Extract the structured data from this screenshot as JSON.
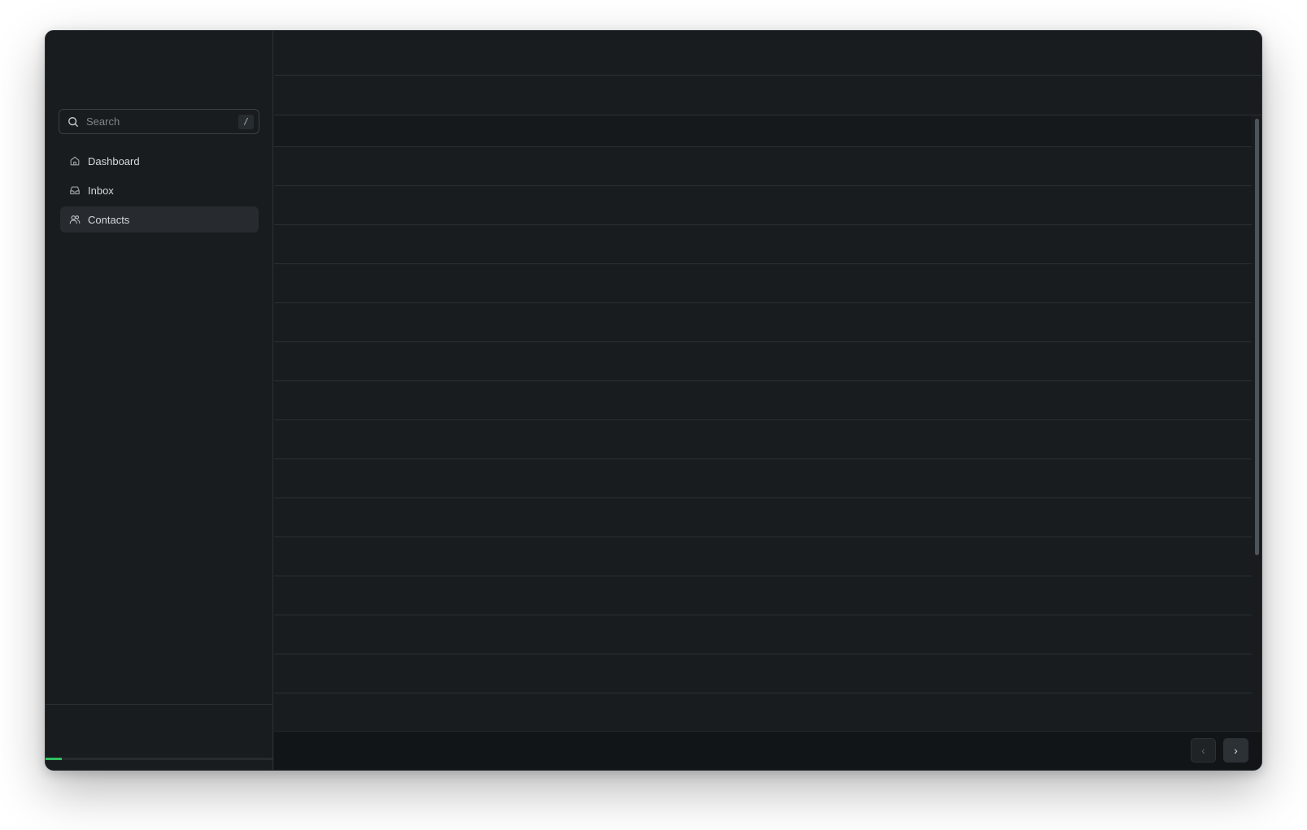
{
  "window": {
    "traffic_colors": [
      "#f5843a",
      "#f5843a",
      "#2dc154"
    ]
  },
  "sidebar": {
    "search": {
      "placeholder": "Search",
      "shortcut": "/"
    },
    "items": [
      {
        "label": "Dashboard",
        "icon": "home-icon",
        "active": false
      },
      {
        "label": "Inbox",
        "icon": "inbox-icon",
        "active": false
      },
      {
        "label": "Contacts",
        "icon": "users-icon",
        "active": true
      }
    ],
    "progress": 0.07
  },
  "pager": {
    "prev_label": "‹",
    "next_label": "›"
  },
  "colors": {
    "accent": "#2fc05e",
    "background": "#181c1f",
    "border": "#2b3035"
  }
}
